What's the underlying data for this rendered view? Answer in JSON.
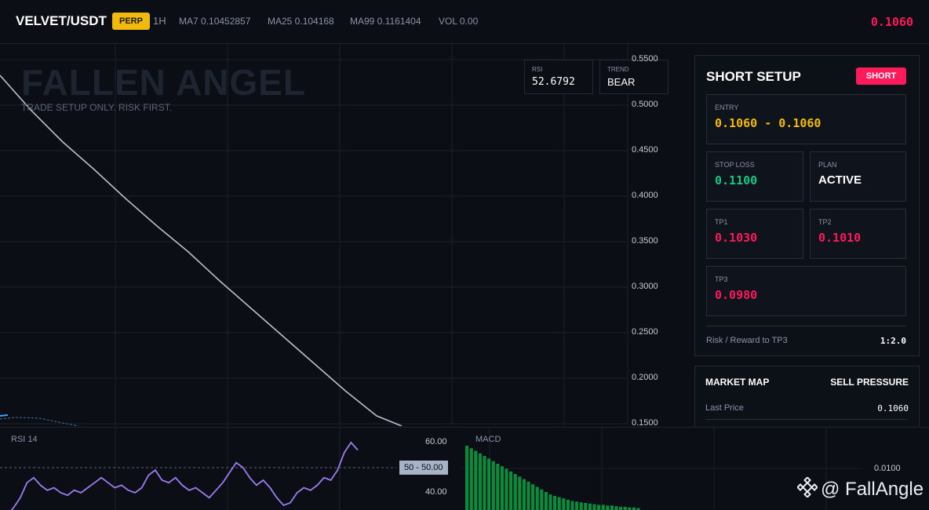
{
  "topbar": {
    "pair": "VELVET/USDT",
    "badge": "PERP",
    "timeframe": "1H",
    "ma7": "MA7 0.10452857",
    "ma25": "MA25 0.104168",
    "ma99": "MA99 0.1161404",
    "vol": "VOL 0.00",
    "last_price": "0.1060"
  },
  "chart": {
    "watermark": "FALLEN ANGEL",
    "subtitle": "TRADE SETUP ONLY. RISK FIRST.",
    "rsi_card": {
      "label": "RSI",
      "value": "52.6792"
    },
    "trend_card": {
      "label": "TREND",
      "value": "BEAR"
    },
    "y_ticks": [
      "0.5500",
      "0.5000",
      "0.4500",
      "0.4000",
      "0.3500",
      "0.3000",
      "0.2500",
      "0.2000",
      "0.1500"
    ]
  },
  "setup": {
    "title": "SHORT SETUP",
    "direction_button": "SHORT",
    "entry": {
      "label": "ENTRY",
      "value": "0.1060 - 0.1060"
    },
    "stop_loss": {
      "label": "STOP LOSS",
      "value": "0.1100"
    },
    "plan": {
      "label": "PLAN",
      "value": "ACTIVE"
    },
    "tp1": {
      "label": "TP1",
      "value": "0.1030"
    },
    "tp2": {
      "label": "TP2",
      "value": "0.1010"
    },
    "tp3": {
      "label": "TP3",
      "value": "0.0980"
    },
    "risk_reward_label": "Risk / Reward to TP3",
    "risk_reward_value": "1:2.0"
  },
  "market_map": {
    "title": "MARKET MAP",
    "status": "SELL PRESSURE",
    "last_price_label": "Last Price",
    "last_price_value": "0.1060"
  },
  "rsi_pane": {
    "title": "RSI 14",
    "ticks": [
      "60.00",
      "40.00"
    ],
    "tag": "50 - 50.00",
    "series": [
      30,
      31,
      34,
      38,
      44,
      46,
      43,
      41,
      42,
      40,
      39,
      41,
      40,
      42,
      44,
      46,
      44,
      42,
      43,
      41,
      40,
      42,
      47,
      49,
      45,
      44,
      46,
      43,
      41,
      42,
      40,
      38,
      41,
      44,
      48,
      52,
      50,
      46,
      43,
      45,
      42,
      38,
      35,
      36,
      40,
      42,
      41,
      43,
      46,
      45,
      49,
      56,
      60,
      57
    ]
  },
  "macd_pane": {
    "title": "MACD",
    "tick": "0.0100",
    "histogram": [
      1.0,
      0.96,
      0.92,
      0.88,
      0.84,
      0.8,
      0.76,
      0.72,
      0.68,
      0.64,
      0.6,
      0.56,
      0.52,
      0.48,
      0.44,
      0.4,
      0.36,
      0.32,
      0.28,
      0.24,
      0.22,
      0.2,
      0.18,
      0.16,
      0.14,
      0.13,
      0.12,
      0.11,
      0.1,
      0.09,
      0.08,
      0.08,
      0.07,
      0.07,
      0.06,
      0.05,
      0.05,
      0.04,
      0.04,
      0.03
    ]
  },
  "brand": "@ FallAngle",
  "colors": {
    "accent_red": "#ff1a5c",
    "accent_yellow": "#f0b90b",
    "accent_green": "#16c784",
    "rsi_line": "#9d7cf0",
    "macd_bar": "#0e8a3a"
  }
}
